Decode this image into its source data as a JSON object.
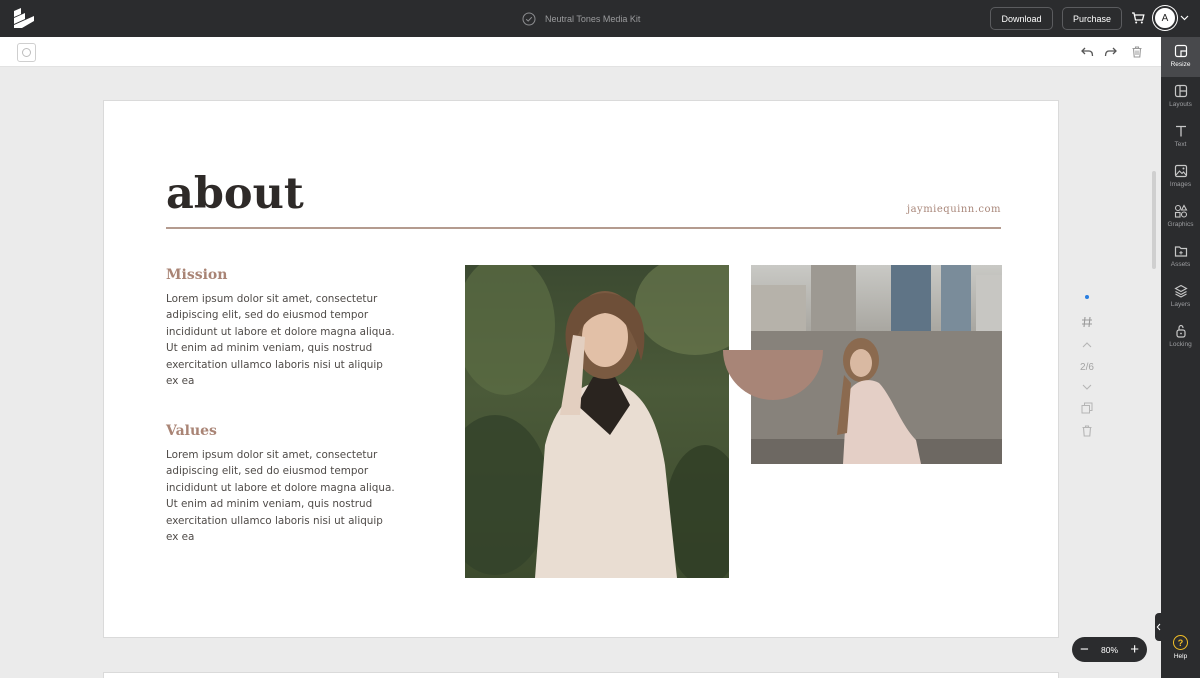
{
  "header": {
    "title": "Neutral Tones Media Kit",
    "download_label": "Download",
    "purchase_label": "Purchase",
    "avatar_initial": "A"
  },
  "sidebar": {
    "items": [
      {
        "label": "Resize",
        "icon": "resize-icon",
        "active": true
      },
      {
        "label": "Layouts",
        "icon": "layouts-icon"
      },
      {
        "label": "Text",
        "icon": "text-icon"
      },
      {
        "label": "Images",
        "icon": "images-icon"
      },
      {
        "label": "Graphics",
        "icon": "graphics-icon"
      },
      {
        "label": "Assets",
        "icon": "assets-icon"
      },
      {
        "label": "Layers",
        "icon": "layers-icon"
      },
      {
        "label": "Locking",
        "icon": "locking-icon"
      }
    ],
    "help_label": "Help",
    "help_symbol": "?"
  },
  "page": {
    "heading": "about",
    "website": "jaymiequinn.com",
    "mission_title": "Mission",
    "mission_body": "Lorem ipsum dolor sit amet, consectetur adipiscing elit, sed do eiusmod tempor incididunt ut labore et dolore magna aliqua. Ut enim ad minim veniam, quis nostrud exercitation ullamco laboris nisi ut aliquip ex ea",
    "values_title": "Values",
    "values_body": "Lorem ipsum dolor sit amet, consectetur adipiscing elit, sed do eiusmod tempor incididunt ut labore et dolore magna aliqua. Ut enim ad minim veniam, quis nostrud exercitation ullamco laboris nisi ut aliquip ex ea",
    "accent_color": "#a88577"
  },
  "page_nav": {
    "current": "2/6"
  },
  "zoom": {
    "value": "80%",
    "minus": "−",
    "plus": "+"
  }
}
